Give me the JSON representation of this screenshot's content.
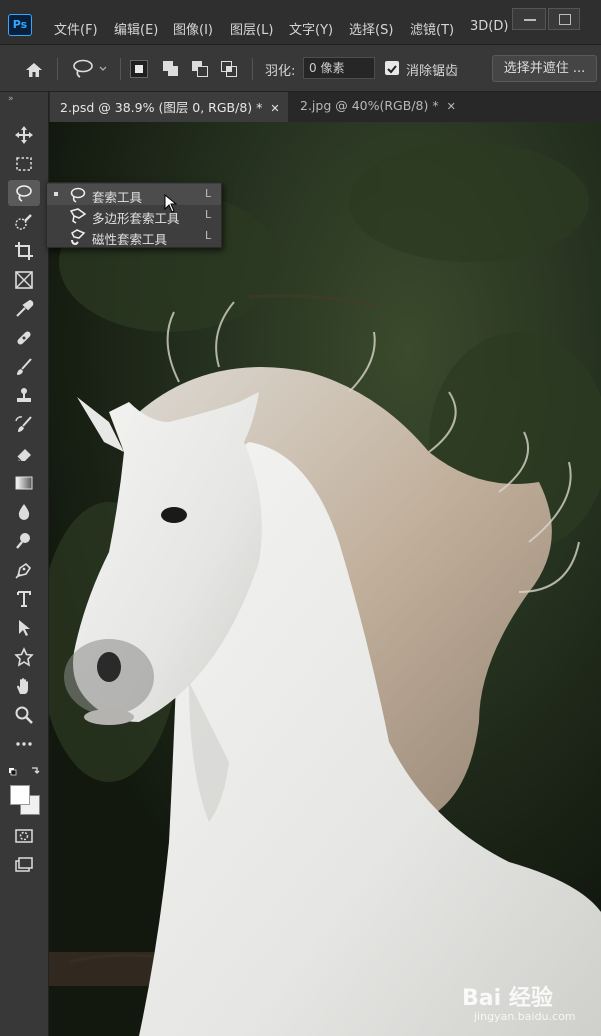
{
  "app": {
    "logo": "Ps",
    "menu": [
      "文件(F)",
      "编辑(E)",
      "图像(I)",
      "图层(L)",
      "文字(Y)",
      "选择(S)",
      "滤镜(T)",
      "3D(D)"
    ]
  },
  "options": {
    "feather_label": "羽化:",
    "feather_value": "0 像素",
    "antialias_label": "消除锯齿",
    "select_mask_label": "选择并遮住 ..."
  },
  "tabs": [
    {
      "label": "2.psd @ 38.9% (图层 0, RGB/8) *",
      "close": "✕"
    },
    {
      "label": "2.jpg @ 40%(RGB/8) *",
      "close": "✕"
    }
  ],
  "flyout": {
    "items": [
      {
        "label": "套索工具",
        "shortcut": "L",
        "icon": "lasso-icon"
      },
      {
        "label": "多边形套索工具",
        "shortcut": "L",
        "icon": "polygonal-lasso-icon"
      },
      {
        "label": "磁性套索工具",
        "shortcut": "L",
        "icon": "magnetic-lasso-icon"
      }
    ]
  },
  "watermark": {
    "logo": "Bai 经验",
    "url": "jingyan.baidu.com"
  },
  "colors": {
    "accent": "#31a8ff",
    "panel": "#383838",
    "menubar": "#2f2f2f"
  }
}
